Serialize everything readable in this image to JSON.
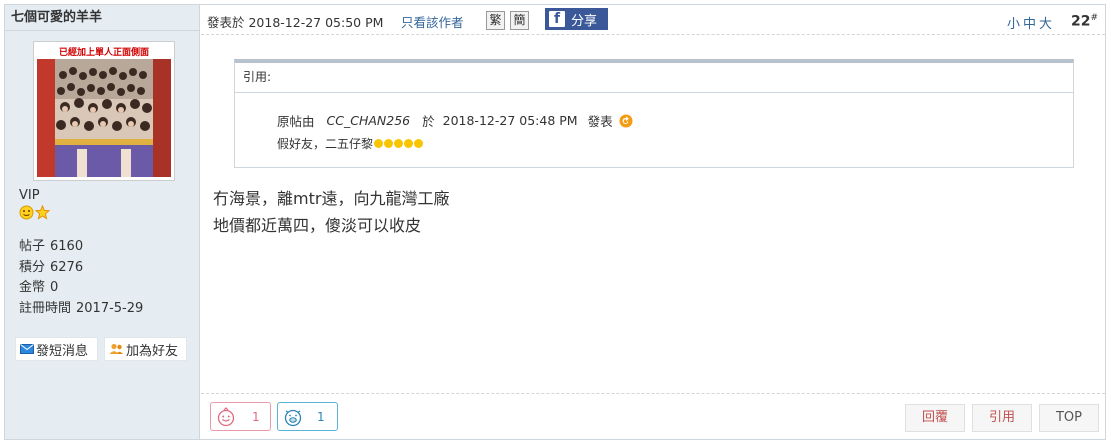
{
  "author": {
    "name": "七個可愛的羊羊",
    "avatar_caption": "已經加上單人正面側面",
    "group": "VIP",
    "badges": [
      "smiley-badge-icon",
      "star-badge-icon"
    ],
    "stats": [
      {
        "label": "帖子",
        "value": "6160"
      },
      {
        "label": "積分",
        "value": "6276"
      },
      {
        "label": "金幣",
        "value": "0"
      },
      {
        "label": "註冊時間",
        "value": "2017-5-29"
      }
    ],
    "pm_button": "發短消息",
    "friend_button": "加為好友"
  },
  "post": {
    "date": "發表於 2018-12-27 05:50 PM",
    "author_only": "只看該作者",
    "traditional": "繁",
    "simplified": "簡",
    "share": "分享",
    "font_sizes": "小中大",
    "floor": "22",
    "floor_mark": "#"
  },
  "quote": {
    "title": "引用:",
    "original_by": "原帖由",
    "user": "CC_CHAN256",
    "at": "於",
    "time": "2018-12-27  05:48  PM",
    "posted": "發表",
    "text": "假好友，二五仔黎"
  },
  "content": {
    "line1": "冇海景，離mtr遠，向九龍灣工廠",
    "line2": "地價都近萬四，傻淡可以收皮"
  },
  "footer": {
    "react1_count": "1",
    "react2_count": "1",
    "reply": "回覆",
    "quote": "引用",
    "top": "TOP"
  },
  "colors": {
    "sidebar_bg": "#e5edf2",
    "link": "#336699",
    "facebook": "#3b5998",
    "footer_button_text": "#c0504d"
  }
}
